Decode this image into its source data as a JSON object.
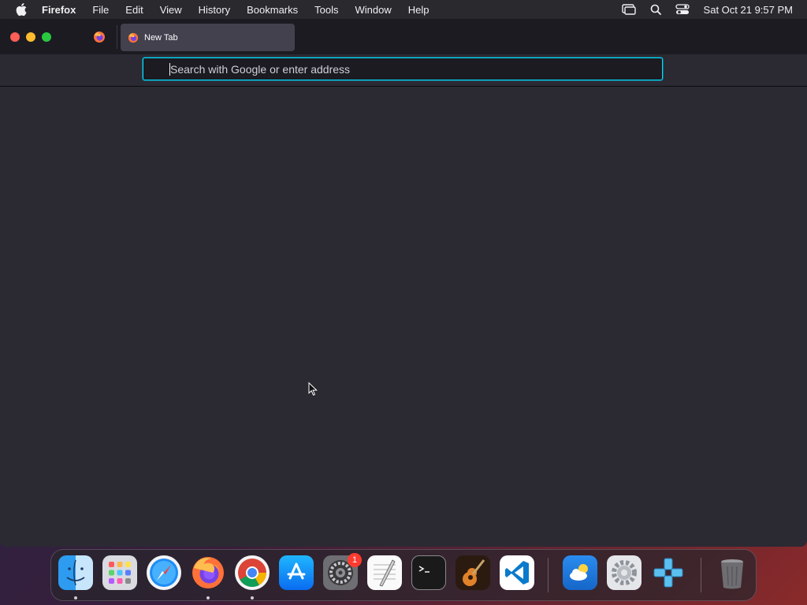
{
  "menubar": {
    "app_name": "Firefox",
    "items": [
      "File",
      "Edit",
      "View",
      "History",
      "Bookmarks",
      "Tools",
      "Window",
      "Help"
    ],
    "clock": "Sat Oct 21  9:57 PM"
  },
  "browser": {
    "tab_title": "New Tab",
    "address_placeholder": "Search with Google or enter address",
    "address_value": ""
  },
  "dock": {
    "apps": [
      {
        "name": "Finder",
        "icon": "finder-icon"
      },
      {
        "name": "Launchpad",
        "icon": "launchpad-icon"
      },
      {
        "name": "Safari",
        "icon": "safari-icon"
      },
      {
        "name": "Firefox",
        "icon": "firefox-icon"
      },
      {
        "name": "Chrome",
        "icon": "chrome-icon"
      },
      {
        "name": "App Store",
        "icon": "app-store-icon"
      },
      {
        "name": "System Preferences",
        "icon": "system-preferences-icon",
        "badge": "1"
      },
      {
        "name": "TextEdit",
        "icon": "textedit-icon"
      },
      {
        "name": "Terminal",
        "icon": "terminal-icon"
      },
      {
        "name": "GarageBand",
        "icon": "garageband-icon"
      },
      {
        "name": "Visual Studio Code",
        "icon": "vscode-icon"
      },
      {
        "name": "Weather",
        "icon": "weather-icon"
      },
      {
        "name": "Settings",
        "icon": "settings-gear-icon"
      },
      {
        "name": "PPSSPP",
        "icon": "ppsspp-icon"
      },
      {
        "name": "Trash",
        "icon": "trash-icon"
      }
    ]
  },
  "colors": {
    "urlbar_focus": "#00ddff",
    "window_bg": "#2b2a33",
    "tab_active": "#42414d",
    "badge": "#ff3b30"
  }
}
